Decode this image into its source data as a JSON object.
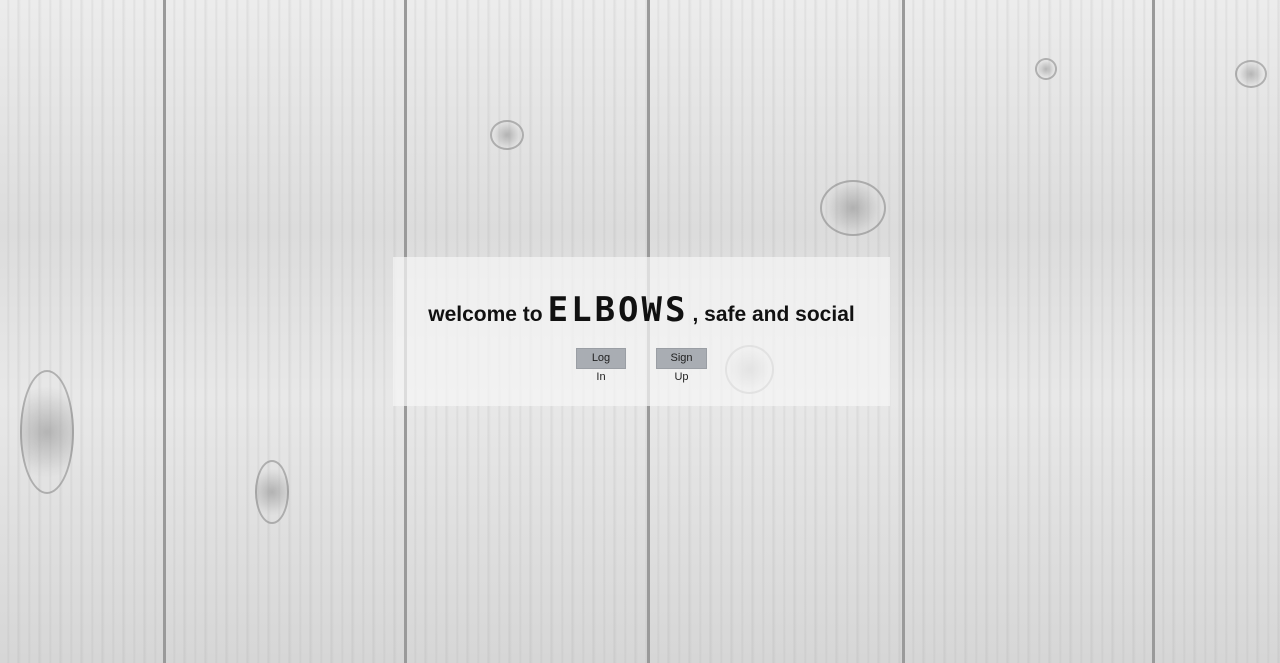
{
  "welcome": {
    "prefix": "welcome to",
    "brand": "ELBOWS",
    "suffix": ", safe and social"
  },
  "buttons": {
    "login": "Log In",
    "signup": "Sign Up"
  }
}
